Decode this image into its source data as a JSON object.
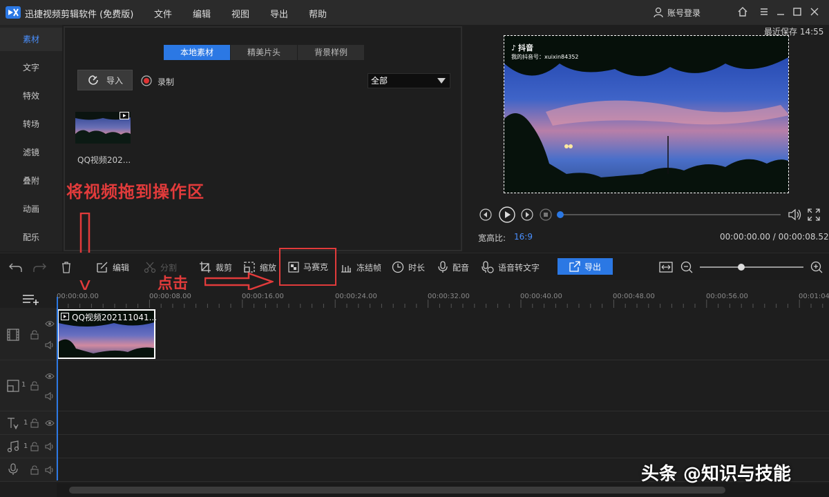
{
  "titlebar": {
    "app_title": "迅捷视频剪辑软件 (免费版)",
    "menu": [
      "文件",
      "编辑",
      "视图",
      "导出",
      "帮助"
    ],
    "account_login": "账号登录"
  },
  "left_nav": {
    "items": [
      "素材",
      "文字",
      "特效",
      "转场",
      "滤镜",
      "叠附",
      "动画",
      "配乐"
    ],
    "active_index": 0
  },
  "media_panel": {
    "tabs": [
      "本地素材",
      "精美片头",
      "背景样例"
    ],
    "active_tab": 0,
    "import_label": "导入",
    "record_label": "录制",
    "filter_value": "全部",
    "media_items": [
      {
        "name": "QQ视频202..."
      }
    ]
  },
  "annotations": {
    "drag_hint": "将视频拖到操作区",
    "click_hint": "点击"
  },
  "preview": {
    "last_saved": "最近保存 14:55",
    "douyin_logo": "抖音",
    "douyin_id": "我的抖音号：xuixin84352",
    "ratio_label": "宽高比:",
    "ratio_value": "16:9",
    "time_readout": "00:00:00.00 / 00:00:08.52",
    "progress": 0.0
  },
  "toolbar": {
    "edit": "编辑",
    "split": "分割",
    "crop": "裁剪",
    "zoom": "缩放",
    "mosaic": "马赛克",
    "freeze": "冻结帧",
    "duration": "时长",
    "dub": "配音",
    "speech_to_text": "语音转文字",
    "export": "导出",
    "zoom_level": 0.4
  },
  "timeline": {
    "ruler": [
      "00:00:00.00",
      "00:00:08.00",
      "00:00:16.00",
      "00:00:24.00",
      "00:00:32.00",
      "00:00:40.00",
      "00:00:48.00",
      "00:00:56.00",
      "00:01:04"
    ],
    "clip_label": "QQ视频202111041...",
    "track_num": "1"
  },
  "watermark": "头条 @知识与技能",
  "colors": {
    "accent": "#2b78e4",
    "annotation_red": "#e23b3b"
  }
}
